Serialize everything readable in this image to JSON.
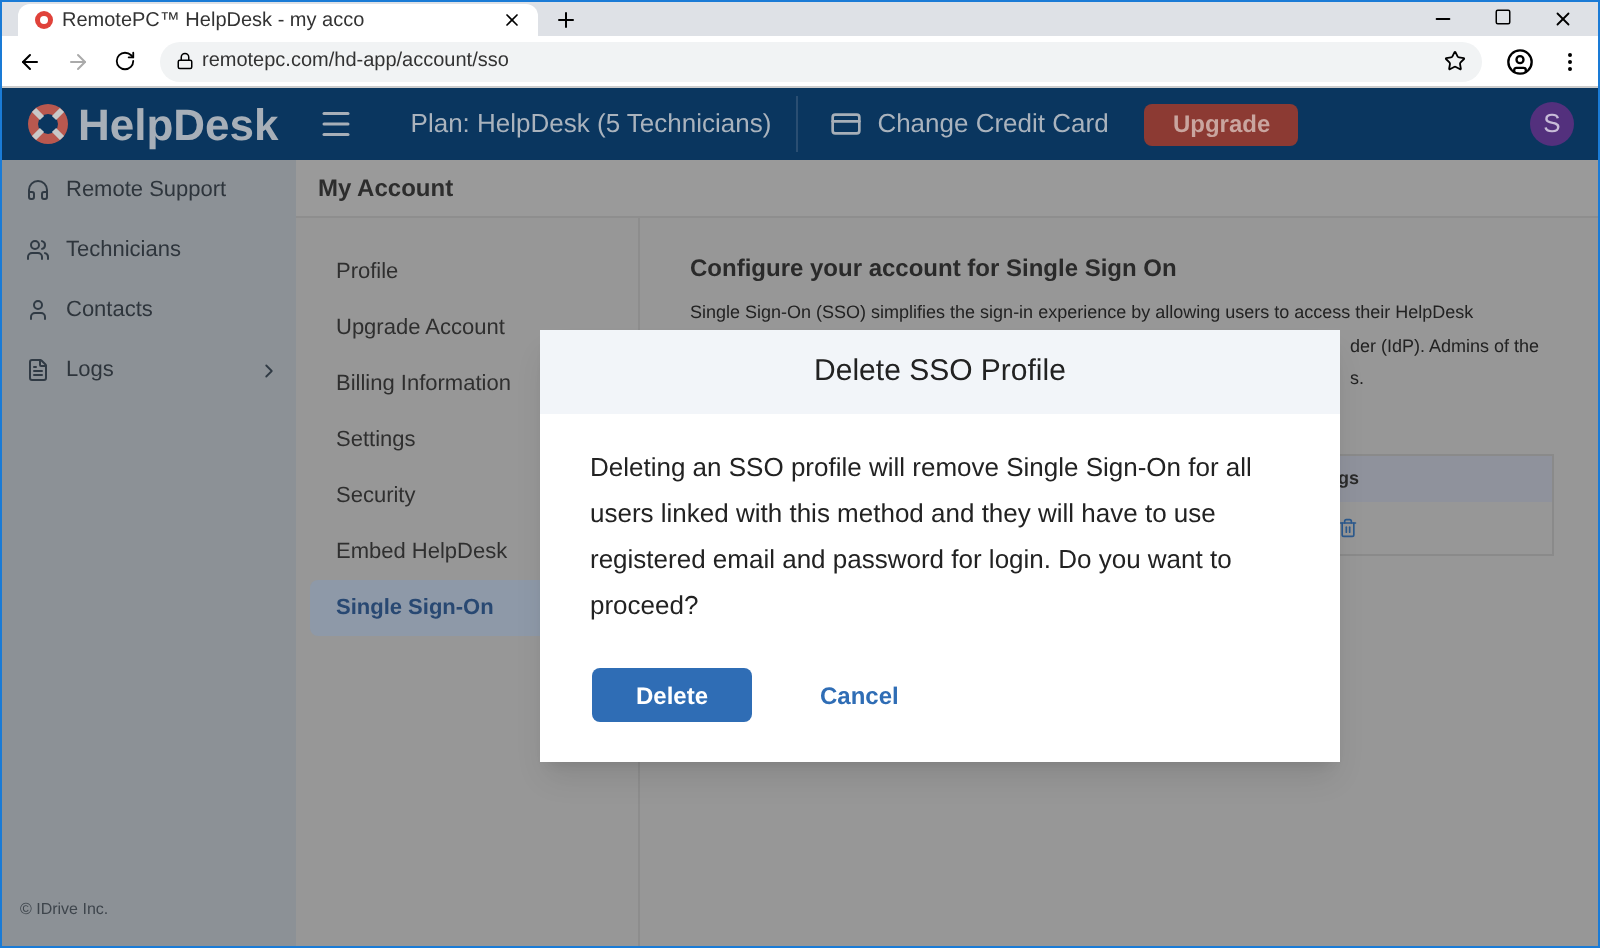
{
  "browser": {
    "tab_title": "RemotePC™ HelpDesk - my acco",
    "address": "remotepc.com/hd-app/account/sso"
  },
  "header": {
    "logo": "HelpDesk",
    "plan": "Plan: HelpDesk (5 Technicians)",
    "card_link": "Change Credit Card",
    "upgrade": "Upgrade",
    "avatar": "S"
  },
  "sidebar": {
    "items": [
      {
        "label": "Remote Support",
        "expandable": false
      },
      {
        "label": "Technicians",
        "expandable": false
      },
      {
        "label": "Contacts",
        "expandable": false
      },
      {
        "label": "Logs",
        "expandable": true
      }
    ],
    "footer": "© IDrive Inc."
  },
  "page_title": "My Account",
  "account_nav": [
    {
      "label": "Profile",
      "selected": false
    },
    {
      "label": "Upgrade Account",
      "selected": false
    },
    {
      "label": "Billing Information",
      "selected": false
    },
    {
      "label": "Settings",
      "selected": false
    },
    {
      "label": "Security",
      "selected": false
    },
    {
      "label": "Embed HelpDesk",
      "selected": false
    },
    {
      "label": "Single Sign-On",
      "selected": true
    }
  ],
  "content": {
    "heading": "Configure your account for Single Sign On",
    "description_line_1": "Single Sign-On (SSO) simplifies the sign-in experience by allowing users to access their HelpDesk",
    "description_fragment_2": "der (IdP). Admins of the",
    "description_fragment_3": "s.",
    "table_header_fragment": "gs"
  },
  "dialog": {
    "title": "Delete SSO Profile",
    "message": "Deleting an SSO profile will remove Single Sign-On for all users linked with this method and they will have to use registered email and password for login. Do you want to proceed?",
    "buttons": [
      {
        "label": "Delete",
        "kind": "primary"
      },
      {
        "label": "Cancel",
        "kind": "link"
      }
    ]
  }
}
